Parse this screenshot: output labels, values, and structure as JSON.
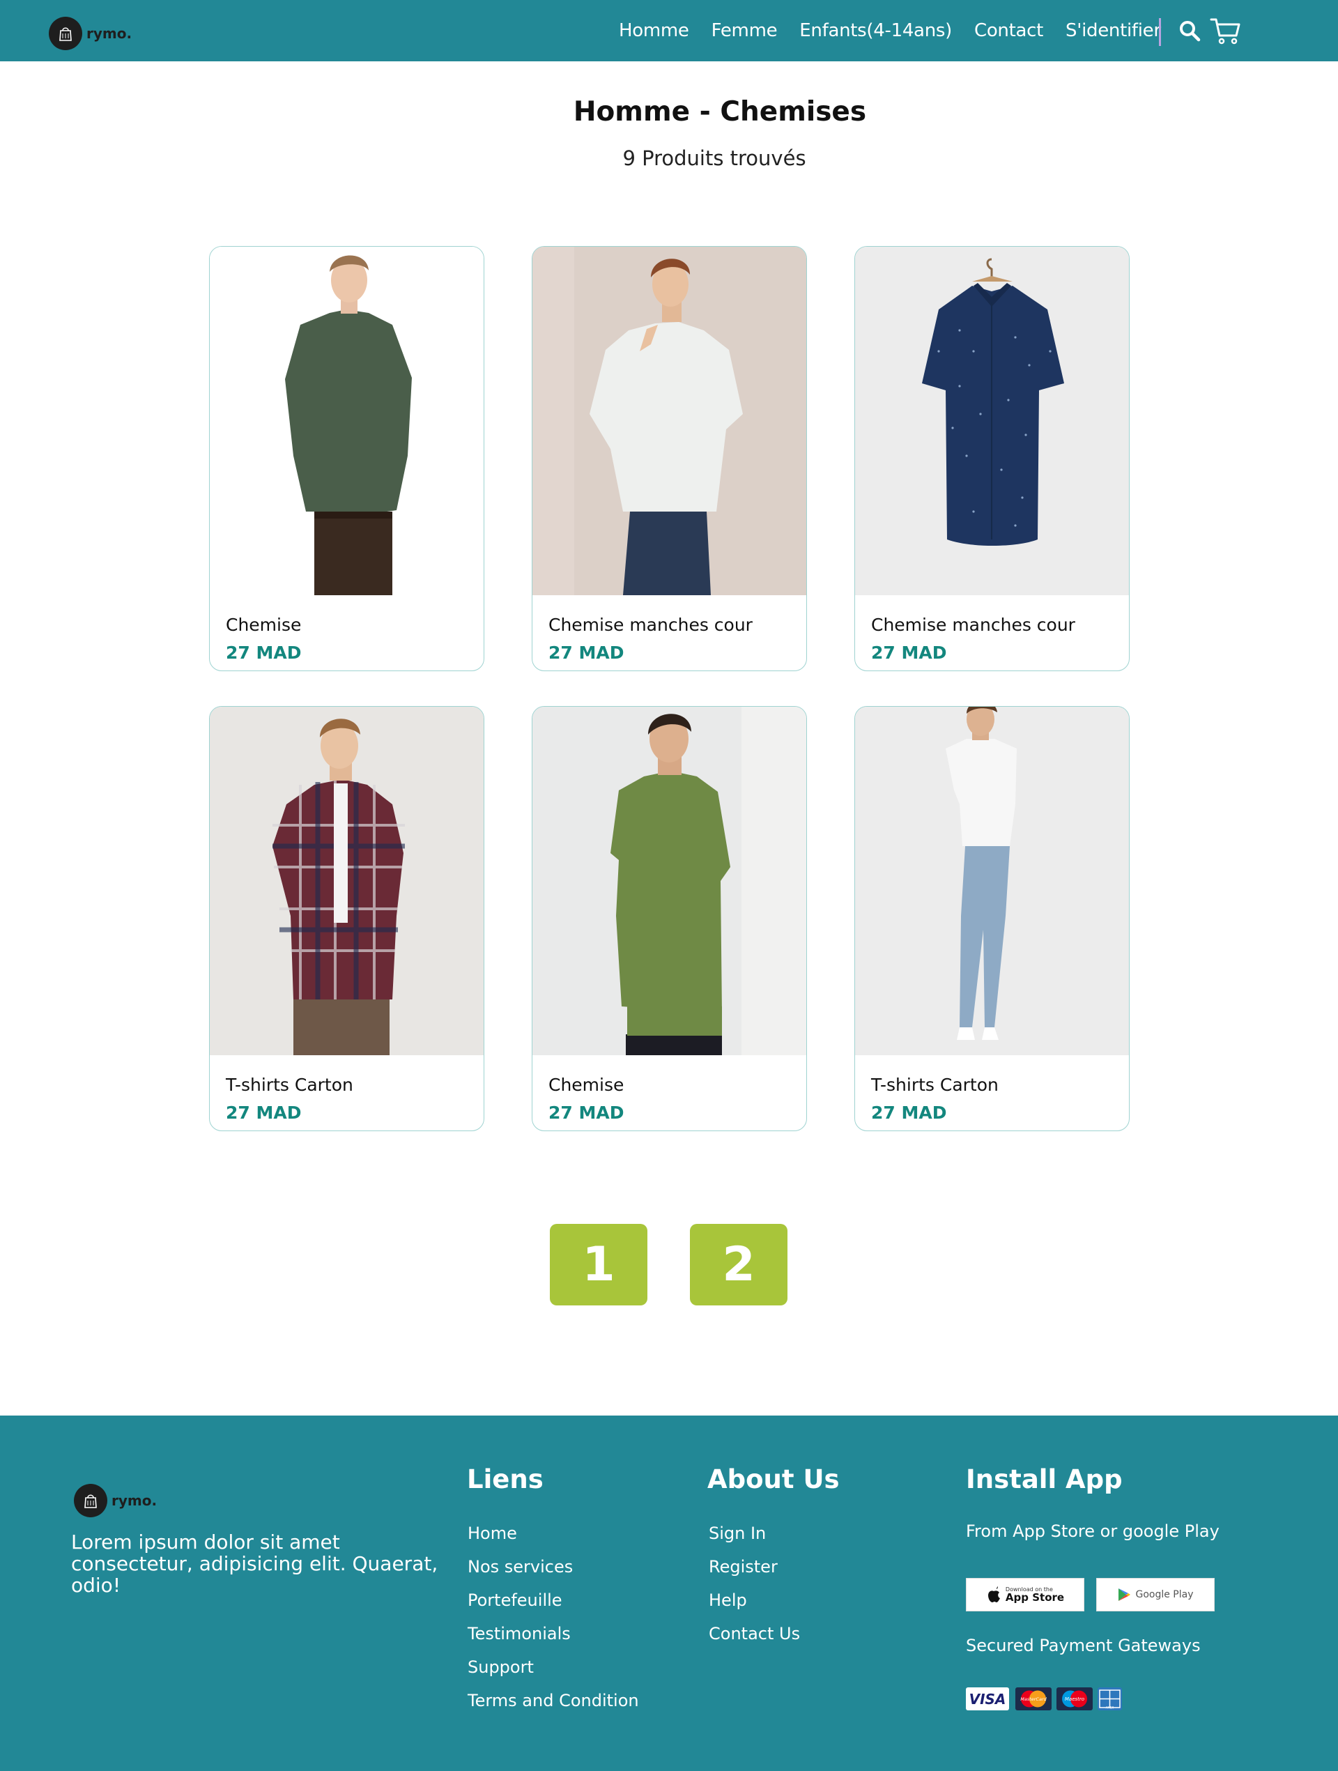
{
  "nav": {
    "brand": "rymo.",
    "links": [
      "Homme",
      "Femme",
      "Enfants(4-14ans)",
      "Contact",
      "S'identifier"
    ],
    "icons": [
      "search-icon",
      "cart-icon"
    ]
  },
  "page": {
    "title": "Homme - Chemises",
    "count": "9 Produits trouvés"
  },
  "products": [
    {
      "name": "Chemise",
      "price": "27 MAD"
    },
    {
      "name": "Chemise manches cour",
      "price": "27 MAD"
    },
    {
      "name": "Chemise manches cour",
      "price": "27 MAD"
    },
    {
      "name": "T-shirts Carton",
      "price": "27 MAD"
    },
    {
      "name": "Chemise",
      "price": "27 MAD"
    },
    {
      "name": "T-shirts Carton",
      "price": "27 MAD"
    }
  ],
  "pagination": {
    "pages": [
      "1",
      "2"
    ]
  },
  "footer": {
    "brand": "rymo.",
    "description": "Lorem ipsum dolor sit amet consectetur, adipisicing elit. Quaerat, odio!",
    "links_title": "Liens",
    "links": [
      "Home",
      "Nos services",
      "Portefeuille",
      "Testimonials",
      "Support",
      "Terms and Condition"
    ],
    "about_title": "About Us",
    "about": [
      "Sign In",
      "Register",
      "Help",
      "Contact Us"
    ],
    "install_title": "Install App",
    "install_text": "From App Store or google Play",
    "app_store_small": "Download on the",
    "app_store": "App Store",
    "google_play": "Google Play",
    "payments_title": "Secured Payment Gateways",
    "payments": [
      "VISA",
      "MasterCard",
      "Maestro",
      "AMEX"
    ]
  },
  "colors": {
    "header_bg": "#228896",
    "price": "#13877e",
    "pagination": "#a8c53a",
    "footer_bg": "#228896"
  }
}
